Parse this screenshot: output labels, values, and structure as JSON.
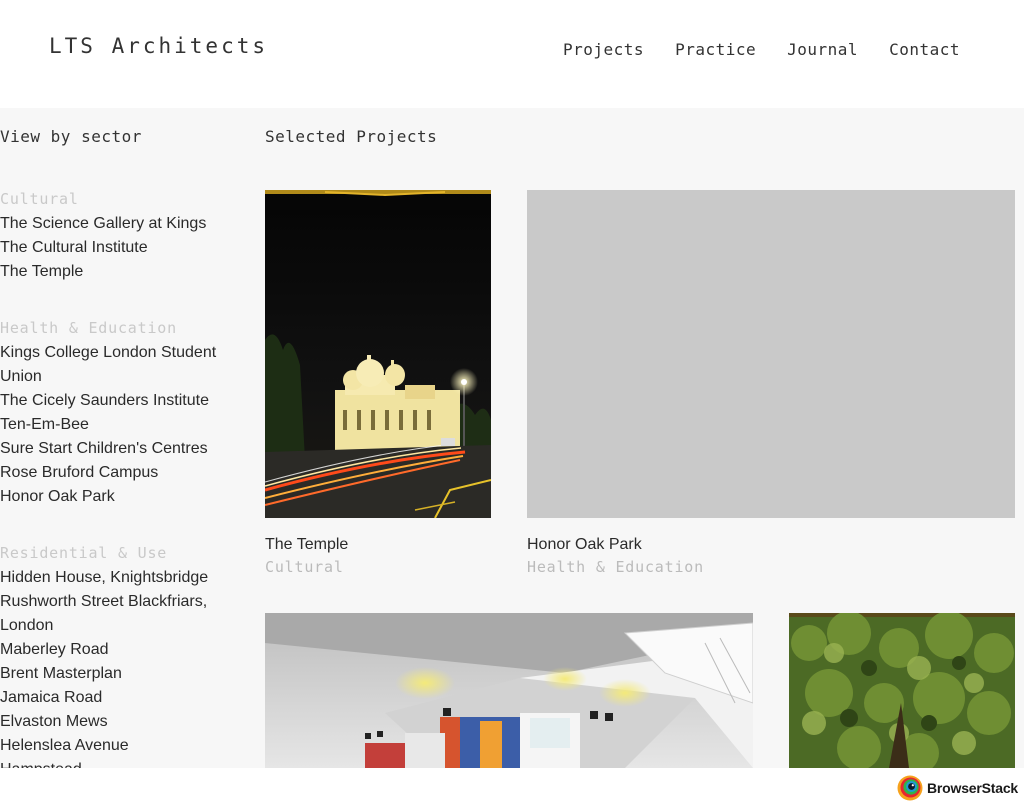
{
  "site": {
    "logo": "LTS Architects"
  },
  "nav": [
    {
      "label": "Projects"
    },
    {
      "label": "Practice"
    },
    {
      "label": "Journal"
    },
    {
      "label": "Contact"
    }
  ],
  "sidebar": {
    "title": "View by sector",
    "groups": [
      {
        "name": "Cultural",
        "items": [
          "The Science Gallery at Kings",
          "The Cultural Institute",
          "The Temple"
        ]
      },
      {
        "name": "Health & Education",
        "items": [
          "Kings College London Student Union",
          "The Cicely Saunders Institute",
          "Ten-Em-Bee",
          "Sure Start Children's Centres",
          "Rose Bruford Campus",
          "Honor Oak Park"
        ]
      },
      {
        "name": "Residential & Use",
        "items": [
          "Hidden House, Knightsbridge",
          "Rushworth Street Blackfriars, London",
          "Maberley Road",
          "Brent Masterplan",
          "Jamaica Road",
          "Elvaston Mews",
          "Helenslea Avenue",
          "Hampstead"
        ]
      }
    ]
  },
  "main": {
    "title": "Selected Projects",
    "projects": [
      {
        "title": "The Temple",
        "sector": "Cultural"
      },
      {
        "title": "Honor Oak Park",
        "sector": "Health & Education"
      },
      {
        "title": "",
        "sector": ""
      },
      {
        "title": "",
        "sector": ""
      }
    ]
  },
  "footer": {
    "badge": "BrowserStack"
  },
  "colors": {
    "page_bg": "#f7f7f7",
    "header_bg": "#ffffff",
    "muted": "#c9c9c9",
    "text": "#2a2a2a",
    "placeholder": "#c9c9c9"
  }
}
